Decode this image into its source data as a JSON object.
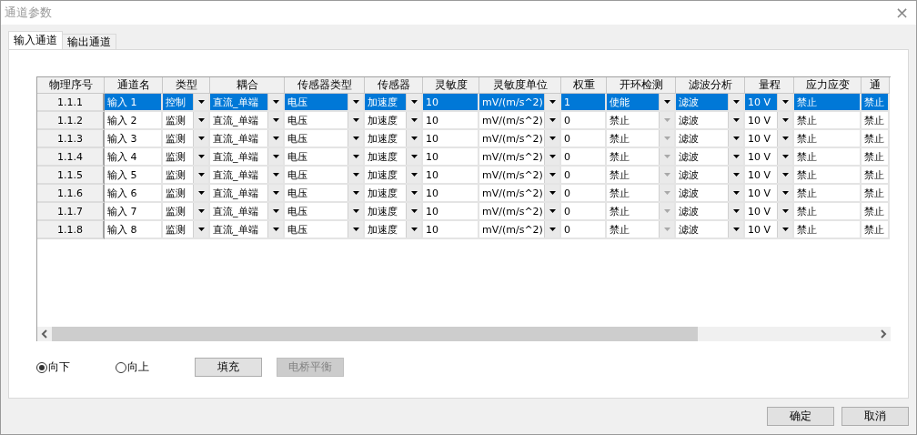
{
  "window": {
    "title": "通道参数",
    "close": "×"
  },
  "tabs": [
    {
      "label": "输入通道",
      "selected": true
    },
    {
      "label": "输出通道",
      "selected": false
    }
  ],
  "table": {
    "columns": [
      "物理序号",
      "通道名",
      "类型",
      "耦合",
      "传感器类型",
      "传感器",
      "灵敏度",
      "灵敏度单位",
      "权重",
      "开环检测",
      "滤波分析",
      "量程",
      "应力应变",
      "通"
    ],
    "rows": [
      {
        "selected": true,
        "cells": [
          {
            "kind": "id",
            "value": "1.1.1"
          },
          {
            "kind": "text",
            "value": "输入 1"
          },
          {
            "kind": "combo",
            "value": "控制",
            "disabled": false
          },
          {
            "kind": "combo",
            "value": "直流_单端",
            "disabled": false
          },
          {
            "kind": "combo",
            "value": "电压",
            "disabled": false
          },
          {
            "kind": "combo",
            "value": "加速度",
            "disabled": false
          },
          {
            "kind": "text",
            "value": "10"
          },
          {
            "kind": "combo",
            "value": "mV/(m/s^2)",
            "disabled": false
          },
          {
            "kind": "text",
            "value": "1"
          },
          {
            "kind": "combo",
            "value": "使能",
            "disabled": false
          },
          {
            "kind": "combo",
            "value": "滤波",
            "disabled": false
          },
          {
            "kind": "combo",
            "value": "10 V",
            "disabled": false
          },
          {
            "kind": "text",
            "value": "禁止"
          },
          {
            "kind": "text",
            "value": "禁止"
          }
        ]
      },
      {
        "selected": false,
        "cells": [
          {
            "kind": "id",
            "value": "1.1.2"
          },
          {
            "kind": "text",
            "value": "输入 2"
          },
          {
            "kind": "combo",
            "value": "监测",
            "disabled": false
          },
          {
            "kind": "combo",
            "value": "直流_单端",
            "disabled": false
          },
          {
            "kind": "combo",
            "value": "电压",
            "disabled": false
          },
          {
            "kind": "combo",
            "value": "加速度",
            "disabled": false
          },
          {
            "kind": "text",
            "value": "10"
          },
          {
            "kind": "combo",
            "value": "mV/(m/s^2)",
            "disabled": false
          },
          {
            "kind": "text",
            "value": "0"
          },
          {
            "kind": "combo",
            "value": "禁止",
            "disabled": true
          },
          {
            "kind": "combo",
            "value": "滤波",
            "disabled": false
          },
          {
            "kind": "combo",
            "value": "10 V",
            "disabled": false
          },
          {
            "kind": "text",
            "value": "禁止"
          },
          {
            "kind": "text",
            "value": "禁止"
          }
        ]
      },
      {
        "selected": false,
        "cells": [
          {
            "kind": "id",
            "value": "1.1.3"
          },
          {
            "kind": "text",
            "value": "输入 3"
          },
          {
            "kind": "combo",
            "value": "监测",
            "disabled": false
          },
          {
            "kind": "combo",
            "value": "直流_单端",
            "disabled": false
          },
          {
            "kind": "combo",
            "value": "电压",
            "disabled": false
          },
          {
            "kind": "combo",
            "value": "加速度",
            "disabled": false
          },
          {
            "kind": "text",
            "value": "10"
          },
          {
            "kind": "combo",
            "value": "mV/(m/s^2)",
            "disabled": false
          },
          {
            "kind": "text",
            "value": "0"
          },
          {
            "kind": "combo",
            "value": "禁止",
            "disabled": true
          },
          {
            "kind": "combo",
            "value": "滤波",
            "disabled": false
          },
          {
            "kind": "combo",
            "value": "10 V",
            "disabled": false
          },
          {
            "kind": "text",
            "value": "禁止"
          },
          {
            "kind": "text",
            "value": "禁止"
          }
        ]
      },
      {
        "selected": false,
        "cells": [
          {
            "kind": "id",
            "value": "1.1.4"
          },
          {
            "kind": "text",
            "value": "输入 4"
          },
          {
            "kind": "combo",
            "value": "监测",
            "disabled": false
          },
          {
            "kind": "combo",
            "value": "直流_单端",
            "disabled": false
          },
          {
            "kind": "combo",
            "value": "电压",
            "disabled": false
          },
          {
            "kind": "combo",
            "value": "加速度",
            "disabled": false
          },
          {
            "kind": "text",
            "value": "10"
          },
          {
            "kind": "combo",
            "value": "mV/(m/s^2)",
            "disabled": false
          },
          {
            "kind": "text",
            "value": "0"
          },
          {
            "kind": "combo",
            "value": "禁止",
            "disabled": true
          },
          {
            "kind": "combo",
            "value": "滤波",
            "disabled": false
          },
          {
            "kind": "combo",
            "value": "10 V",
            "disabled": false
          },
          {
            "kind": "text",
            "value": "禁止"
          },
          {
            "kind": "text",
            "value": "禁止"
          }
        ]
      },
      {
        "selected": false,
        "cells": [
          {
            "kind": "id",
            "value": "1.1.5"
          },
          {
            "kind": "text",
            "value": "输入 5"
          },
          {
            "kind": "combo",
            "value": "监测",
            "disabled": false
          },
          {
            "kind": "combo",
            "value": "直流_单端",
            "disabled": false
          },
          {
            "kind": "combo",
            "value": "电压",
            "disabled": false
          },
          {
            "kind": "combo",
            "value": "加速度",
            "disabled": false
          },
          {
            "kind": "text",
            "value": "10"
          },
          {
            "kind": "combo",
            "value": "mV/(m/s^2)",
            "disabled": false
          },
          {
            "kind": "text",
            "value": "0"
          },
          {
            "kind": "combo",
            "value": "禁止",
            "disabled": true
          },
          {
            "kind": "combo",
            "value": "滤波",
            "disabled": false
          },
          {
            "kind": "combo",
            "value": "10 V",
            "disabled": false
          },
          {
            "kind": "text",
            "value": "禁止"
          },
          {
            "kind": "text",
            "value": "禁止"
          }
        ]
      },
      {
        "selected": false,
        "cells": [
          {
            "kind": "id",
            "value": "1.1.6"
          },
          {
            "kind": "text",
            "value": "输入 6"
          },
          {
            "kind": "combo",
            "value": "监测",
            "disabled": false
          },
          {
            "kind": "combo",
            "value": "直流_单端",
            "disabled": false
          },
          {
            "kind": "combo",
            "value": "电压",
            "disabled": false
          },
          {
            "kind": "combo",
            "value": "加速度",
            "disabled": false
          },
          {
            "kind": "text",
            "value": "10"
          },
          {
            "kind": "combo",
            "value": "mV/(m/s^2)",
            "disabled": false
          },
          {
            "kind": "text",
            "value": "0"
          },
          {
            "kind": "combo",
            "value": "禁止",
            "disabled": true
          },
          {
            "kind": "combo",
            "value": "滤波",
            "disabled": false
          },
          {
            "kind": "combo",
            "value": "10 V",
            "disabled": false
          },
          {
            "kind": "text",
            "value": "禁止"
          },
          {
            "kind": "text",
            "value": "禁止"
          }
        ]
      },
      {
        "selected": false,
        "cells": [
          {
            "kind": "id",
            "value": "1.1.7"
          },
          {
            "kind": "text",
            "value": "输入 7"
          },
          {
            "kind": "combo",
            "value": "监测",
            "disabled": false
          },
          {
            "kind": "combo",
            "value": "直流_单端",
            "disabled": false
          },
          {
            "kind": "combo",
            "value": "电压",
            "disabled": false
          },
          {
            "kind": "combo",
            "value": "加速度",
            "disabled": false
          },
          {
            "kind": "text",
            "value": "10"
          },
          {
            "kind": "combo",
            "value": "mV/(m/s^2)",
            "disabled": false
          },
          {
            "kind": "text",
            "value": "0"
          },
          {
            "kind": "combo",
            "value": "禁止",
            "disabled": true
          },
          {
            "kind": "combo",
            "value": "滤波",
            "disabled": false
          },
          {
            "kind": "combo",
            "value": "10 V",
            "disabled": false
          },
          {
            "kind": "text",
            "value": "禁止"
          },
          {
            "kind": "text",
            "value": "禁止"
          }
        ]
      },
      {
        "selected": false,
        "cells": [
          {
            "kind": "id",
            "value": "1.1.8"
          },
          {
            "kind": "text",
            "value": "输入 8"
          },
          {
            "kind": "combo",
            "value": "监测",
            "disabled": false
          },
          {
            "kind": "combo",
            "value": "直流_单端",
            "disabled": false
          },
          {
            "kind": "combo",
            "value": "电压",
            "disabled": false
          },
          {
            "kind": "combo",
            "value": "加速度",
            "disabled": false
          },
          {
            "kind": "text",
            "value": "10"
          },
          {
            "kind": "combo",
            "value": "mV/(m/s^2)",
            "disabled": false
          },
          {
            "kind": "text",
            "value": "0"
          },
          {
            "kind": "combo",
            "value": "禁止",
            "disabled": true
          },
          {
            "kind": "combo",
            "value": "滤波",
            "disabled": false
          },
          {
            "kind": "combo",
            "value": "10 V",
            "disabled": false
          },
          {
            "kind": "text",
            "value": "禁止"
          },
          {
            "kind": "text",
            "value": "禁止"
          }
        ]
      }
    ]
  },
  "direction": [
    {
      "label": "向下",
      "selected": true
    },
    {
      "label": "向上",
      "selected": false
    }
  ],
  "actions": [
    {
      "label": "填充",
      "disabled": false
    },
    {
      "label": "电桥平衡",
      "disabled": true
    }
  ],
  "buttons": [
    "确定",
    "取消"
  ]
}
